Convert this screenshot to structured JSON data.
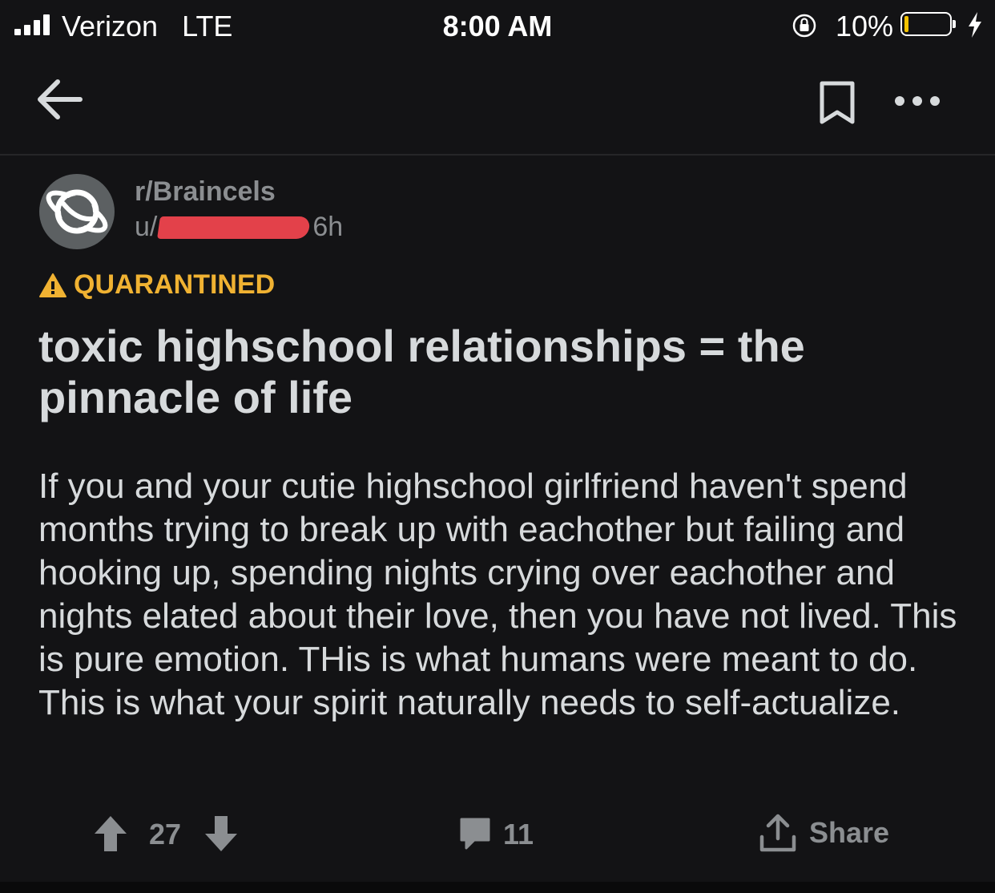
{
  "status_bar": {
    "carrier": "Verizon",
    "network": "LTE",
    "time": "8:00 AM",
    "battery_percent": "10%",
    "battery_level": 0.1,
    "battery_color": "#f2c200"
  },
  "nav": {
    "back_icon": "arrow-left-icon",
    "bookmark_icon": "bookmark-icon",
    "more_icon": "more-horizontal-icon"
  },
  "post": {
    "subreddit": "r/Braincels",
    "user_prefix": "u/",
    "age": "6h",
    "quarantine_label": "QUARANTINED",
    "quarantine_color": "#f0b232",
    "title": "toxic highschool relationships = the pinnacle of life",
    "body": "If you and your cutie highschool girlfriend haven't spend months trying to break up with eachother but failing and hooking up, spending nights crying over eachother and nights elated about their love, then you have not lived. This is pure emotion. THis is what humans were meant to do. This is what your spirit naturally needs to self-actualize."
  },
  "actions": {
    "score": "27",
    "comments": "11",
    "share_label": "Share"
  }
}
